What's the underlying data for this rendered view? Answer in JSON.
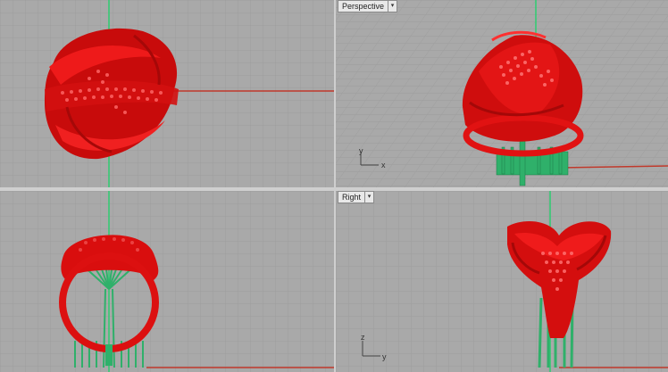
{
  "viewports": {
    "top_left": {
      "label": ""
    },
    "perspective": {
      "label": "Perspective",
      "axes": {
        "y": "y",
        "x": "x"
      }
    },
    "bottom_left": {
      "label": ""
    },
    "right": {
      "label": "Right",
      "axes": {
        "z": "z",
        "y": "y"
      }
    }
  },
  "colors": {
    "viewport_bg": "#a9a9a9",
    "grid_line": "#9d9d9d",
    "model": "#e01111",
    "supports": "#2fb06a",
    "x_axis": "#c0392b",
    "z_axis": "#2ecc71"
  },
  "icons": {
    "dropdown": "chevron-down-icon"
  }
}
